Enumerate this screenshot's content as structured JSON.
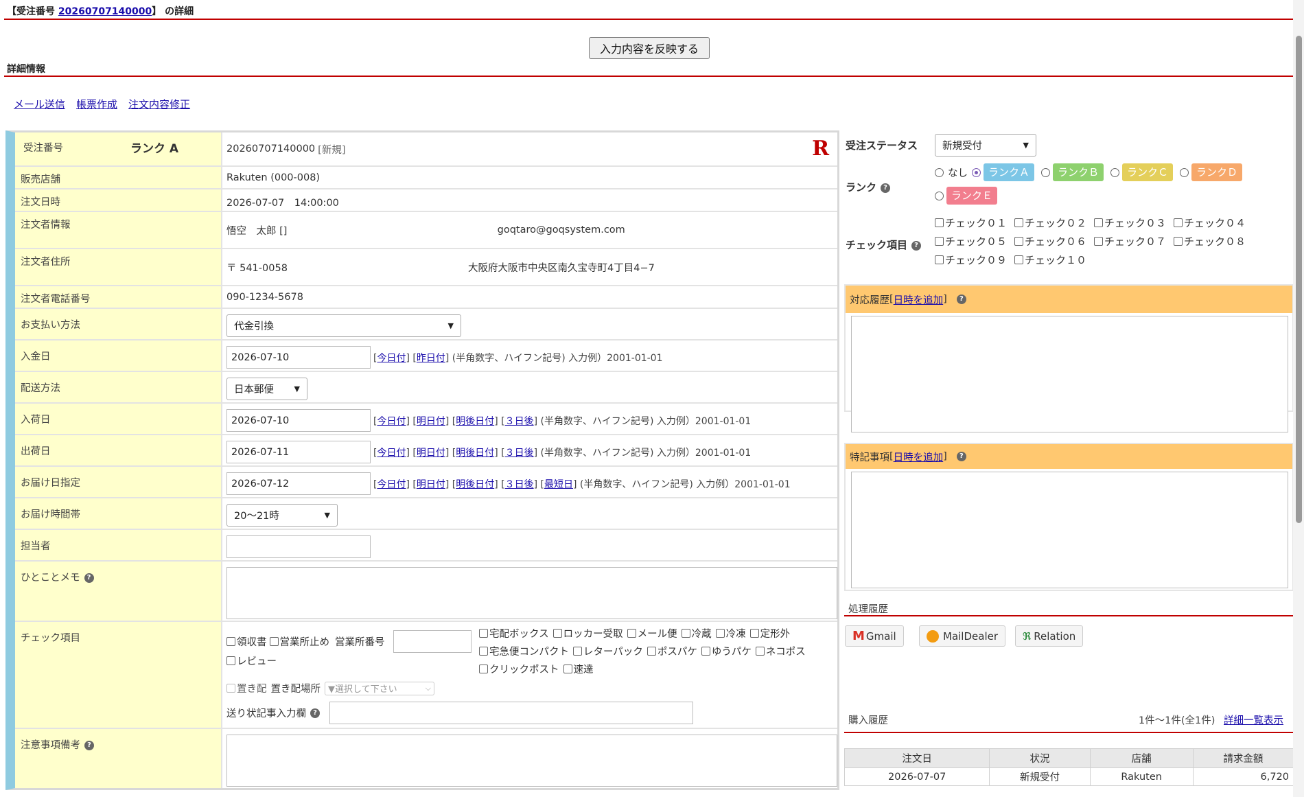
{
  "header": {
    "prefix": "【受注番号 ",
    "order_no": "20260707140000",
    "suffix": "】 の詳細"
  },
  "apply_button": "入力内容を反映する",
  "detail_title": "詳細情報",
  "actions": [
    "メール送信",
    "帳票作成",
    "注文内容修正"
  ],
  "fields": {
    "order_no_label": "受注番号",
    "rank_text": "ランク A",
    "order_no_value": "20260707140000",
    "order_tag": "[新規]",
    "shop_label": "販売店舗",
    "shop_value": "Rakuten (000-008)",
    "order_date_label": "注文日時",
    "order_date_value": "2026-07-07　14:00:00",
    "customer_label": "注文者情報",
    "customer_name": "悟空　太郎 []",
    "customer_email": "goqtaro@goqsystem.com",
    "address_label": "注文者住所",
    "zip": "〒 541-0058",
    "address": "大阪府大阪市中央区南久宝寺町4丁目4−7",
    "phone_label": "注文者電話番号",
    "phone": "090-1234-5678",
    "payment_label": "お支払い方法",
    "payment_value": "代金引換",
    "deposit_label": "入金日",
    "deposit_value": "2026-07-10",
    "ship_method_label": "配送方法",
    "ship_method_value": "日本郵便",
    "arrival_label": "入荷日",
    "arrival_value": "2026-07-10",
    "shipping_label": "出荷日",
    "shipping_value": "2026-07-11",
    "delivery_label": "お届け日指定",
    "delivery_value": "2026-07-12",
    "timeslot_label": "お届け時間帯",
    "timeslot_value": "20～21時",
    "staff_label": "担当者",
    "memo_label": "ひとことメモ",
    "check_label": "チェック項目",
    "notes_label": "注意事項備考"
  },
  "date_links": {
    "today": "今日付",
    "yesterday": "昨日付",
    "tomorrow": "明日付",
    "day_after": "明後日付",
    "three_days": "３日後",
    "earliest": "最短日"
  },
  "date_hint": "(半角数字、ハイフン記号) 入力例）2001-01-01",
  "checks": {
    "receipt": "領収書",
    "office_stop": "営業所止め",
    "office_no": "営業所番号",
    "review": "レビュー",
    "right": [
      "宅配ボックス",
      "ロッカー受取",
      "メール便",
      "冷蔵",
      "冷凍",
      "定形外",
      "宅急便コンパクト",
      "レターパック",
      "ポスパケ",
      "ゆうパケ",
      "ネコポス",
      "クリックポスト",
      "速達"
    ],
    "okihai": "置き配",
    "okihai_place": "置き配場所",
    "okihai_select": "▼選択して下さい",
    "slip_label": "送り状記事入力欄"
  },
  "status": {
    "label": "受注ステータス",
    "value": "新規受付"
  },
  "rank": {
    "label": "ランク",
    "none": "なし",
    "options": [
      {
        "label": "ランクＡ",
        "color": "#7cc6e6"
      },
      {
        "label": "ランクＢ",
        "color": "#8ed16e"
      },
      {
        "label": "ランクＣ",
        "color": "#e4cf5a"
      },
      {
        "label": "ランクＤ",
        "color": "#f7a86a"
      },
      {
        "label": "ランクＥ",
        "color": "#f27e8e"
      }
    ]
  },
  "check_items": {
    "label": "チェック項目",
    "items": [
      "チェック０１",
      "チェック０２",
      "チェック０３",
      "チェック０４",
      "チェック０５",
      "チェック０６",
      "チェック０７",
      "チェック０８",
      "チェック０９",
      "チェック１０"
    ]
  },
  "history_panel": {
    "title": "対応履歴",
    "add": "日時を追加"
  },
  "special_panel": {
    "title": "特記事項",
    "add": "日時を追加"
  },
  "process_title": "処理履歴",
  "services": [
    "Gmail",
    "MailDealer",
    "Relation"
  ],
  "purchase": {
    "title": "購入履歴",
    "count": "1件～1件(全1件)",
    "link": "詳細一覧表示",
    "columns": [
      "注文日",
      "状況",
      "店舗",
      "請求金額"
    ],
    "rows": [
      [
        "2026-07-07",
        "新規受付",
        "Rakuten",
        "6,720"
      ]
    ]
  }
}
